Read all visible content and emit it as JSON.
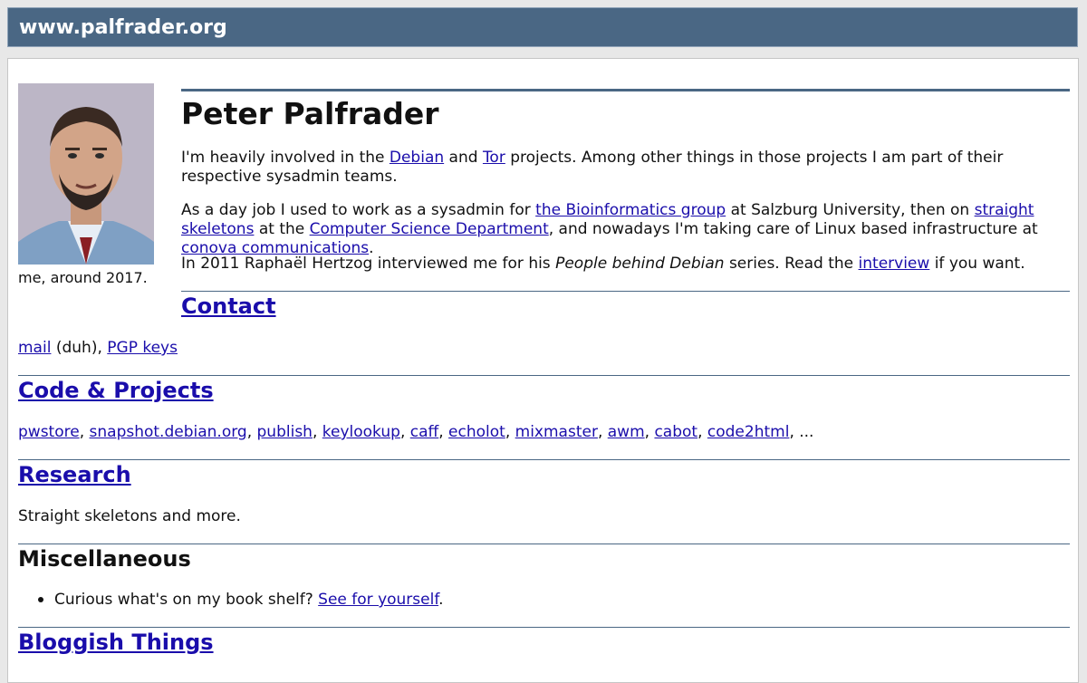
{
  "site": {
    "title": "www.palfrader.org"
  },
  "profile": {
    "name": "Peter Palfrader",
    "photo_caption": "me, around 2017."
  },
  "intro": {
    "p1": {
      "t1": "I'm heavily involved in the ",
      "link_debian": "Debian",
      "t2": " and ",
      "link_tor": "Tor",
      "t3": " projects. Among other things in those projects I am part of their respective sysadmin teams."
    },
    "p2": {
      "t1": "As a day job I used to work as a sysadmin for ",
      "link_bioinf": "the Bioinformatics group",
      "t2": " at Salzburg University, then on ",
      "link_skeletons": "straight skeletons",
      "t3": " at the ",
      "link_csdept": "Computer Science Department",
      "t4": ", and nowadays I'm taking care of Linux based infrastructure at ",
      "link_conova": "conova communications",
      "t5": "."
    },
    "p3": {
      "t1": "In 2011 Raphaël Hertzog interviewed me for his ",
      "em": "People behind Debian",
      "t2": " series. Read the ",
      "link_interview": "interview",
      "t3": " if you want."
    }
  },
  "contact": {
    "heading": "Contact",
    "link_mail": "mail",
    "t1": " (duh), ",
    "link_pgp": "PGP keys"
  },
  "code": {
    "heading": "Code & Projects",
    "links": [
      "pwstore",
      "snapshot.debian.org",
      "publish",
      "keylookup",
      "caff",
      "echolot",
      "mixmaster",
      "awm",
      "cabot",
      "code2html"
    ],
    "sep": ", ",
    "trail": ", ..."
  },
  "research": {
    "heading": "Research",
    "text": "Straight skeletons and more."
  },
  "misc": {
    "heading": "Miscellaneous",
    "item_text": "Curious what's on my book shelf? ",
    "item_link": "See for yourself",
    "item_end": "."
  },
  "blog": {
    "heading": "Bloggish Things"
  },
  "colors": {
    "banner": "#4a6784",
    "link": "#1a0dab",
    "rule": "#4a6784"
  }
}
